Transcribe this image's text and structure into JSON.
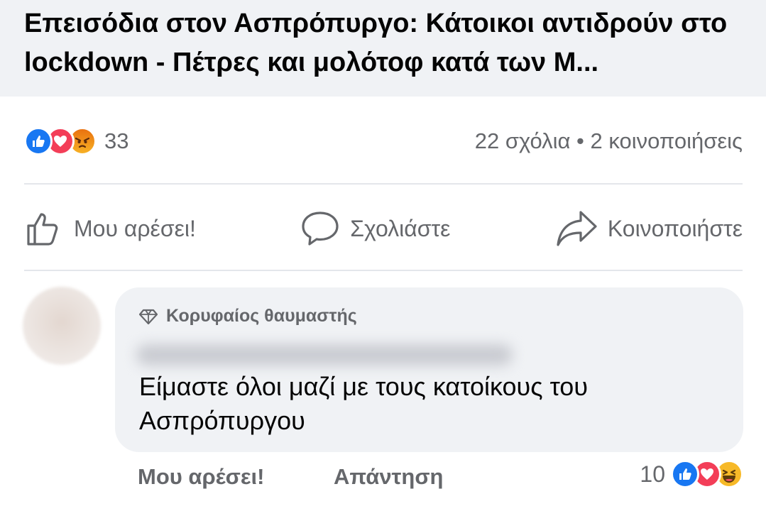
{
  "link_preview": {
    "title": "Επεισόδια στον Ασπρόπυργο: Κάτοικοι αντιδρούν στο lockdown - Πέτρες και μολότοφ κατά των Μ..."
  },
  "post_stats": {
    "reaction_icons": [
      "like-reaction-icon",
      "love-reaction-icon",
      "angry-reaction-icon"
    ],
    "reaction_count": "33",
    "comments_shares": "22 σχόλια • 2 κοινοποιήσεις"
  },
  "actions": {
    "like_label": "Μου αρέσει!",
    "comment_label": "Σχολιάστε",
    "share_label": "Κοινοποιήστε"
  },
  "comment": {
    "badge": "Κορυφαίος θαυμαστής",
    "text": "Είμαστε όλοι μαζί με τους κατοίκους του Ασπρόπυργου",
    "like_label": "Μου αρέσει!",
    "reply_label": "Απάντηση",
    "reaction_count": "10",
    "reaction_icons": [
      "like-reaction-icon",
      "love-reaction-icon",
      "haha-reaction-icon"
    ]
  },
  "colors": {
    "facebook_blue": "#1877f2",
    "love_red": "#f33e58",
    "secondary_text": "#65676b",
    "bubble_bg": "#f0f2f5"
  }
}
